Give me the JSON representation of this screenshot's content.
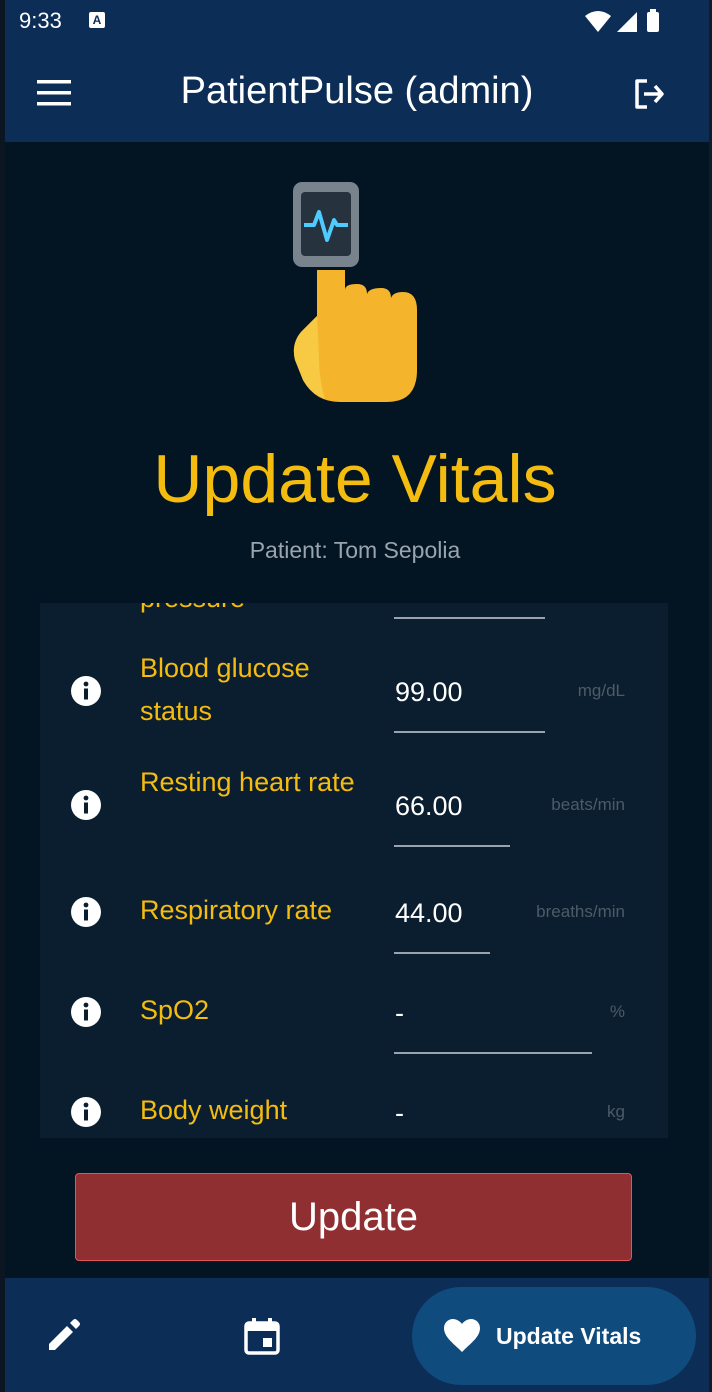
{
  "status_bar": {
    "time": "9:33",
    "badge": "A"
  },
  "app_bar": {
    "title": "PatientPulse (admin)"
  },
  "header": {
    "title": "Update Vitals",
    "patient": "Patient: Tom Sepolia"
  },
  "vitals": [
    {
      "label": "pressure",
      "value": "",
      "unit": ""
    },
    {
      "label": "Blood glucose status",
      "value": "99.00",
      "unit": "mg/dL"
    },
    {
      "label": "Resting heart rate",
      "value": "66.00",
      "unit": "beats/min"
    },
    {
      "label": "Respiratory rate",
      "value": "44.00",
      "unit": "breaths/min"
    },
    {
      "label": "SpO2",
      "value": "-",
      "unit": "%"
    },
    {
      "label": "Body weight",
      "value": "-",
      "unit": "kg"
    }
  ],
  "actions": {
    "update_label": "Update"
  },
  "bottom_nav": {
    "active_label": "Update Vitals"
  },
  "colors": {
    "accent": "#f5bc10",
    "appbar": "#0c2d56",
    "update_button": "#8f2f31"
  }
}
